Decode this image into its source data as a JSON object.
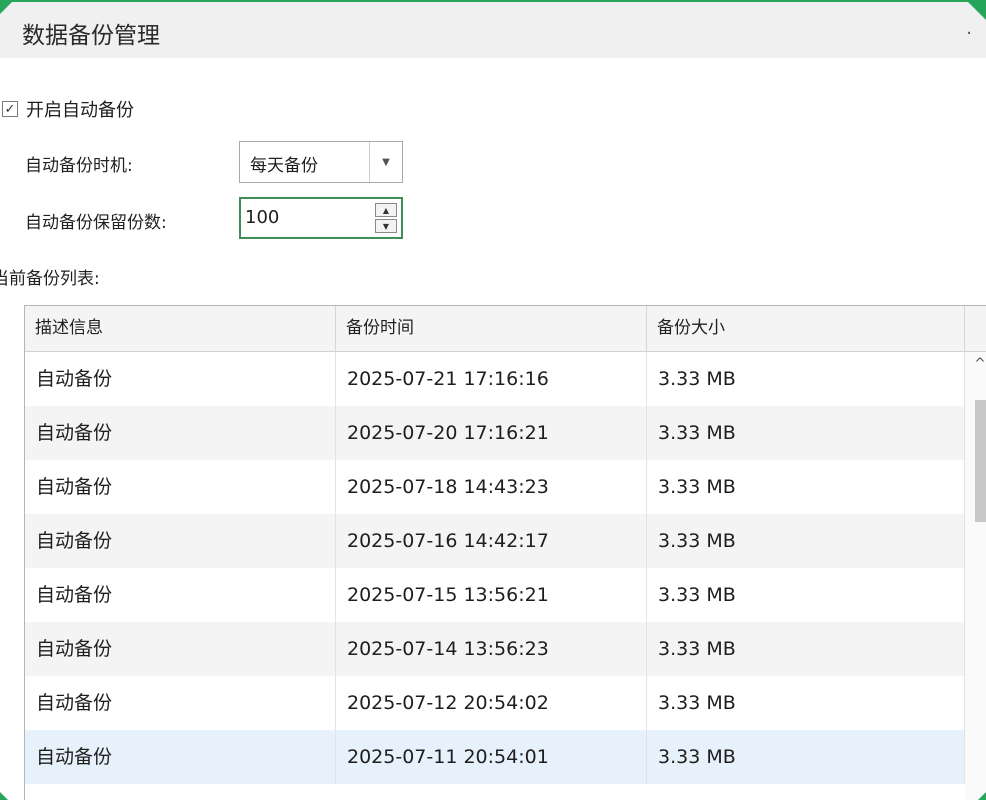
{
  "window": {
    "title": "数据备份管理",
    "menu_glyph": "."
  },
  "auto_backup": {
    "enabled": true,
    "checkbox_glyph": "✓",
    "label": "开启自动备份"
  },
  "timing": {
    "label": "自动备份时机:",
    "value": "每天备份"
  },
  "retention": {
    "label": "自动备份保留份数:",
    "value": "100"
  },
  "list": {
    "label": "当前备份列表:",
    "columns": [
      "描述信息",
      "备份时间",
      "备份大小"
    ],
    "rows": [
      [
        "自动备份",
        "2025-07-21 17:16:16",
        "3.33 MB"
      ],
      [
        "自动备份",
        "2025-07-20 17:16:21",
        "3.33 MB"
      ],
      [
        "自动备份",
        "2025-07-18 14:43:23",
        "3.33 MB"
      ],
      [
        "自动备份",
        "2025-07-16 14:42:17",
        "3.33 MB"
      ],
      [
        "自动备份",
        "2025-07-15 13:56:21",
        "3.33 MB"
      ],
      [
        "自动备份",
        "2025-07-14 13:56:23",
        "3.33 MB"
      ],
      [
        "自动备份",
        "2025-07-12 20:54:02",
        "3.33 MB"
      ],
      [
        "自动备份",
        "2025-07-11 20:54:01",
        "3.33 MB"
      ]
    ],
    "selected_row": 7
  },
  "colors": {
    "accent": "#27a55b",
    "selected_row": "#e6f1fb"
  },
  "icons": {
    "dropdown": "▼",
    "spin_up": "▲",
    "spin_down": "▼",
    "scroll_up": "^"
  }
}
